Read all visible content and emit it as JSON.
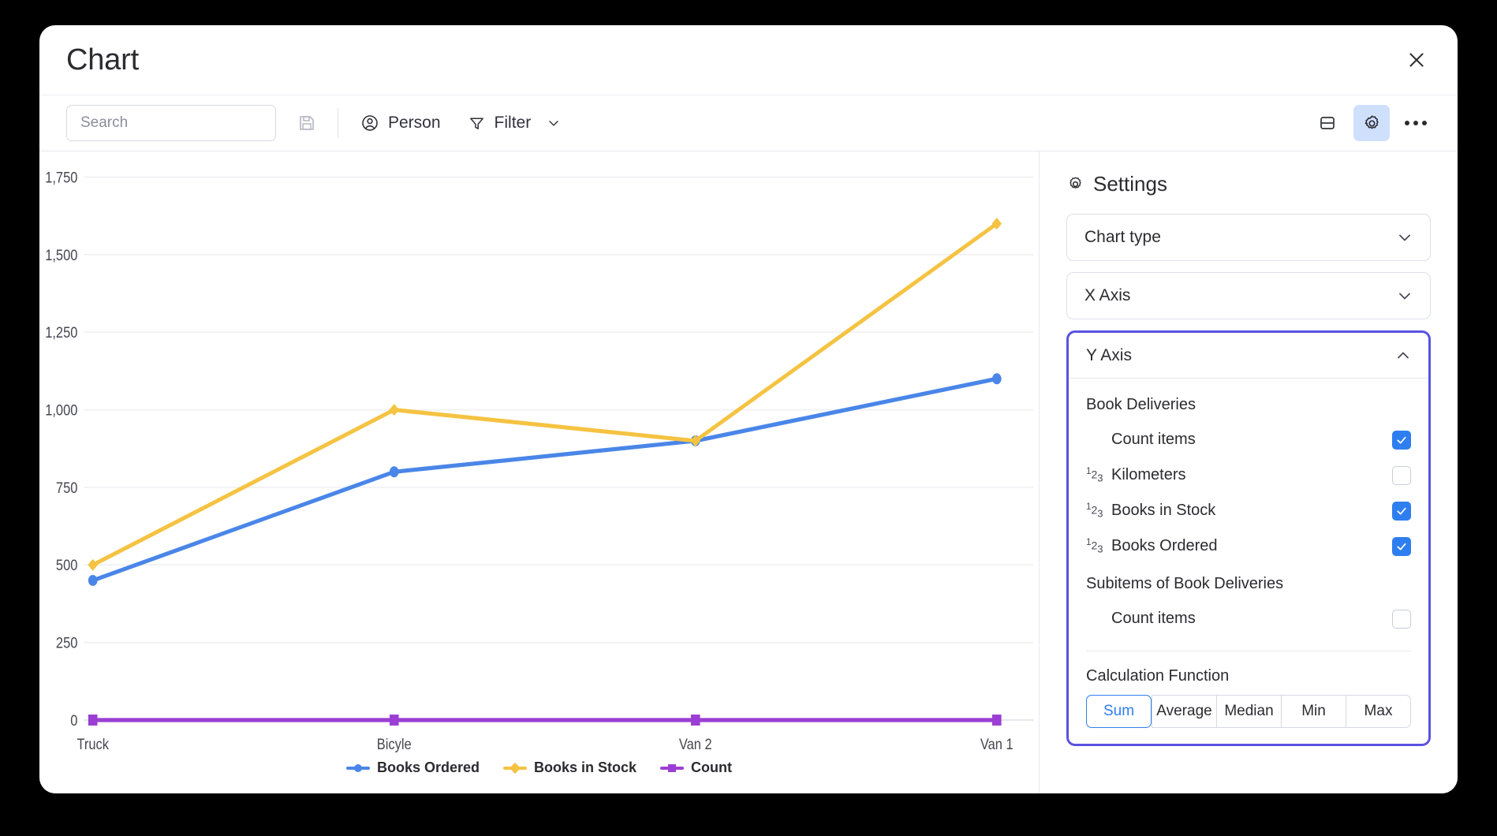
{
  "window": {
    "title": "Chart",
    "close_label": "×"
  },
  "toolbar": {
    "search": {
      "placeholder": "Search",
      "value": ""
    },
    "save_icon": "floppy-disk-icon",
    "person_label": "Person",
    "filter_label": "Filter",
    "split_view_icon": "split-view-icon",
    "settings_icon": "gear-icon",
    "more_icon": "more-options-icon"
  },
  "settings": {
    "title": "Settings",
    "sections": [
      {
        "label": "Chart type",
        "expanded": false
      },
      {
        "label": "X Axis",
        "expanded": false
      },
      {
        "label": "Y Axis",
        "expanded": true,
        "selected": true
      }
    ],
    "y_axis": {
      "groups": [
        {
          "title": "Book Deliveries",
          "options": [
            {
              "label": "Count items",
              "icon": "",
              "checked": true
            },
            {
              "label": "Kilometers",
              "icon": "123",
              "checked": false
            },
            {
              "label": "Books in Stock",
              "icon": "123",
              "checked": true
            },
            {
              "label": "Books Ordered",
              "icon": "123",
              "checked": true
            }
          ]
        },
        {
          "title": "Subitems of Book Deliveries",
          "options": [
            {
              "label": "Count items",
              "icon": "",
              "checked": false
            }
          ]
        }
      ],
      "calculation": {
        "title": "Calculation Function",
        "options": [
          "Sum",
          "Average",
          "Median",
          "Min",
          "Max"
        ],
        "selected": "Sum"
      }
    }
  },
  "colors": {
    "books_ordered": "#4a86e8",
    "books_in_stock": "#f5c342",
    "count": "#9b3fd4",
    "accent_blue": "#2f7ef0",
    "selected_purple": "#5a52e0"
  },
  "chart_data": {
    "type": "line",
    "title": "",
    "xlabel": "",
    "ylabel": "",
    "categories": [
      "Truck",
      "Bicyle",
      "Van 2",
      "Van 1"
    ],
    "ylim": [
      0,
      1750
    ],
    "yticks": [
      0,
      250,
      500,
      750,
      1000,
      1250,
      1500,
      1750
    ],
    "ytick_labels": [
      "0",
      "250",
      "500",
      "750",
      "1,000",
      "1,250",
      "1,500",
      "1,750"
    ],
    "grid": true,
    "legend_position": "bottom",
    "series": [
      {
        "name": "Books Ordered",
        "color": "#4a86e8",
        "marker": "circle",
        "values": [
          450,
          800,
          900,
          1100
        ]
      },
      {
        "name": "Books in Stock",
        "color": "#f5c342",
        "marker": "diamond",
        "values": [
          500,
          1000,
          900,
          1600
        ]
      },
      {
        "name": "Count",
        "color": "#9b3fd4",
        "marker": "square",
        "values": [
          0,
          0,
          0,
          0
        ]
      }
    ]
  }
}
